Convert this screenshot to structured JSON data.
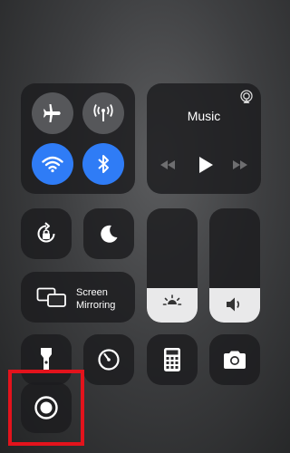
{
  "connectivity": {
    "airplane": {
      "icon": "airplane-icon",
      "state": "off"
    },
    "cellular": {
      "icon": "antenna-icon",
      "state": "off"
    },
    "wifi": {
      "icon": "wifi-icon",
      "state": "on"
    },
    "bluetooth": {
      "icon": "bluetooth-icon",
      "state": "on"
    },
    "accent_color": "#2f7cf6"
  },
  "music": {
    "title": "Music",
    "airplay_icon": "airplay-icon",
    "controls": [
      "rewind-icon",
      "play-icon",
      "fast-forward-icon"
    ]
  },
  "toggles": {
    "rotation_lock": "rotation-lock-icon",
    "do_not_disturb": "moon-icon"
  },
  "screen_mirroring": {
    "line1": "Screen",
    "line2": "Mirroring",
    "icon": "screen-mirroring-icon"
  },
  "sliders": {
    "brightness": {
      "icon": "brightness-icon",
      "level": 0.3
    },
    "volume": {
      "icon": "speaker-icon",
      "level": 0.3
    }
  },
  "bottom_row": [
    "flashlight-icon",
    "timer-icon",
    "calculator-icon",
    "camera-icon"
  ],
  "screen_recording": {
    "icon": "screen-record-icon",
    "highlight_color": "#e3131c"
  }
}
